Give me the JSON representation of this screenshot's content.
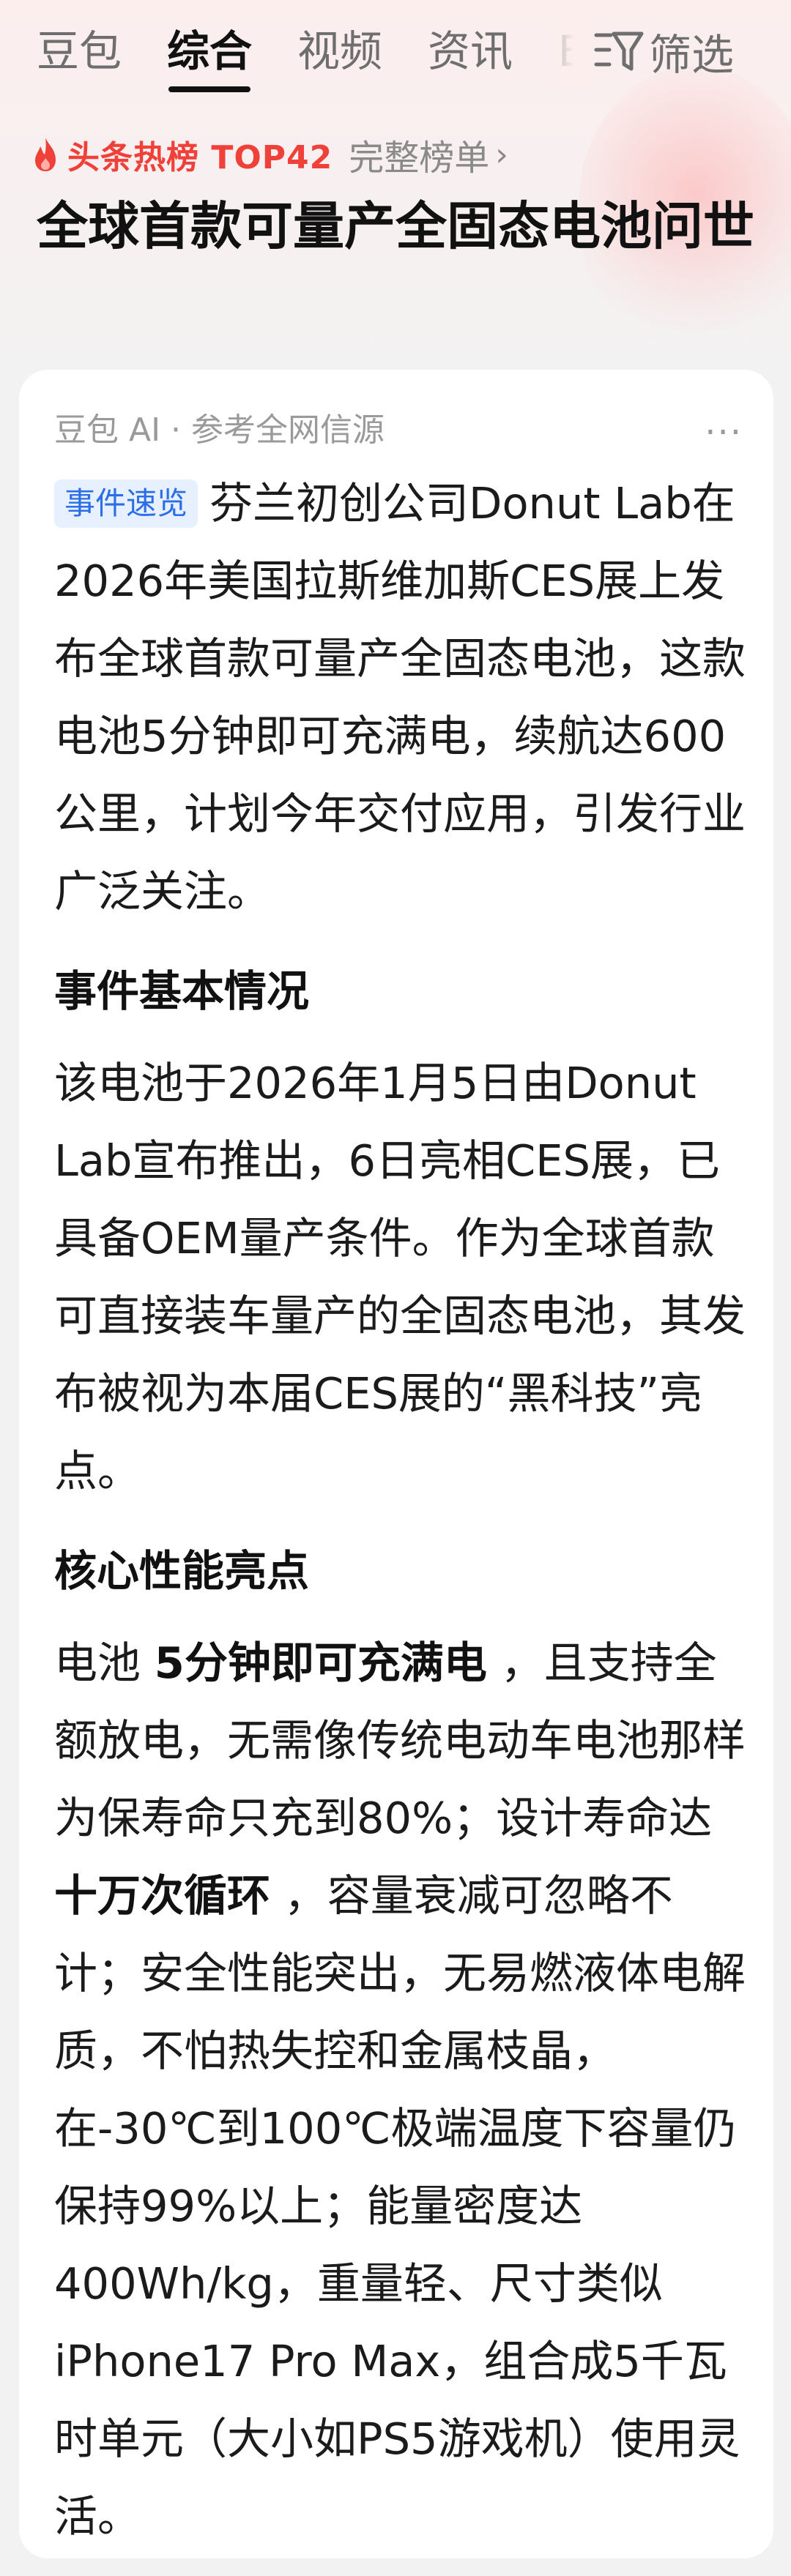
{
  "nav": {
    "tabs": [
      "豆包",
      "综合",
      "视频",
      "资讯",
      "E"
    ],
    "active_index": 1,
    "filter_label": "筛选"
  },
  "hot": {
    "label": "头条热榜 TOP42",
    "full_list": "完整榜单"
  },
  "headline": "全球首款可量产全固态电池问世",
  "card": {
    "source": "豆包 AI · 参考全网信源",
    "badge": "事件速览",
    "summary": "芬兰初创公司Donut Lab在2026年美国拉斯维加斯CES展上发布全球首款可量产全固态电池，这款电池5分钟即可充满电，续航达600公里，计划今年交付应用，引发行业广泛关注。",
    "section1_title": "事件基本情况",
    "section1_body": "该电池于2026年1月5日由Donut Lab宣布推出，6日亮相CES展，已具备OEM量产条件。作为全球首款可直接装车量产的全固态电池，其发布被视为本届CES展的“黑科技”亮点。",
    "section2_title": "核心性能亮点",
    "section2_p1": "电池 ",
    "section2_b1": "5分钟即可充满电",
    "section2_p2": " ，且支持全额放电，无需像传统电动车电池那样为保寿命只充到80%；设计寿命达 ",
    "section2_b2": "十万次循环",
    "section2_p3": " ，容量衰减可忽略不计；安全性能突出，无易燃液体电解质，不怕热失控和金属枝晶，在-30℃到100℃极端温度下容量仍保持99%以上；能量密度达400Wh/kg，重量轻、尺寸类似iPhone17 Pro Max，组合成5千瓦时单元（大小如PS5游戏机）使用灵活。"
  },
  "colors": {
    "accent_red": "#f0403a",
    "badge_blue": "#2c6ee8",
    "badge_bg": "#e6f0ff"
  }
}
